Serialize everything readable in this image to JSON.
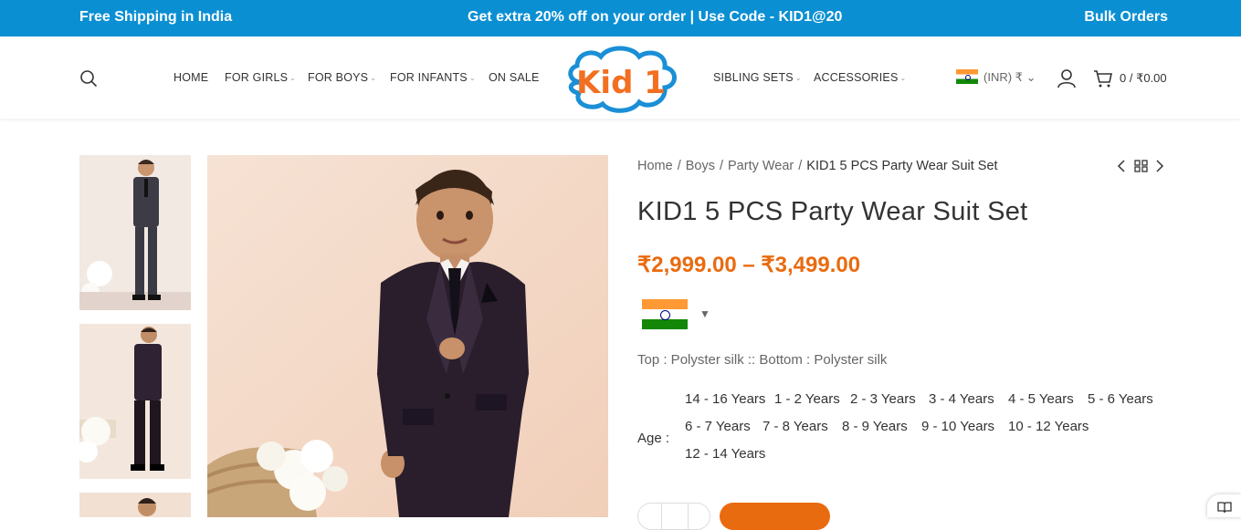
{
  "topbar": {
    "left": "Free Shipping in India",
    "center": "Get extra 20% off on your order | Use Code - KID1@20",
    "right": "Bulk Orders"
  },
  "nav": {
    "home": "HOME",
    "girls": "FOR GIRLS",
    "boys": "FOR BOYS",
    "infants": "FOR INFANTS",
    "sale": "ON SALE",
    "siblings": "SIBLING SETS",
    "accessories": "ACCESSORIES"
  },
  "logo": {
    "text": "Kid 1"
  },
  "currency": "(INR) ₹",
  "cart": {
    "summary": "0 / ₹0.00"
  },
  "breadcrumb": [
    "Home",
    "Boys",
    "Party Wear",
    "KID1 5 PCS Party Wear Suit Set"
  ],
  "product": {
    "title": "KID1 5 PCS Party Wear Suit Set",
    "price": "₹2,999.00 – ₹3,499.00",
    "material": "Top : Polyster silk :: Bottom : Polyster silk",
    "age_label": "Age :",
    "ages": [
      "14 - 16 Years",
      "1 - 2 Years",
      "2 - 3 Years",
      "3 - 4 Years",
      "4 - 5 Years",
      "5 - 6 Years",
      "6 - 7 Years",
      "7 - 8 Years",
      "8 - 9 Years",
      "9 - 10 Years",
      "10 - 12 Years",
      "12 - 14 Years"
    ]
  },
  "colors": {
    "topbar": "#0b8fd3",
    "accent": "#e96b10",
    "logo_orange": "#f26f21",
    "logo_blue": "#1a8fd6"
  },
  "icons": [
    "search-icon",
    "user-icon",
    "cart-icon",
    "chevron-left-icon",
    "grid-icon",
    "chevron-right-icon",
    "reader-icon"
  ]
}
